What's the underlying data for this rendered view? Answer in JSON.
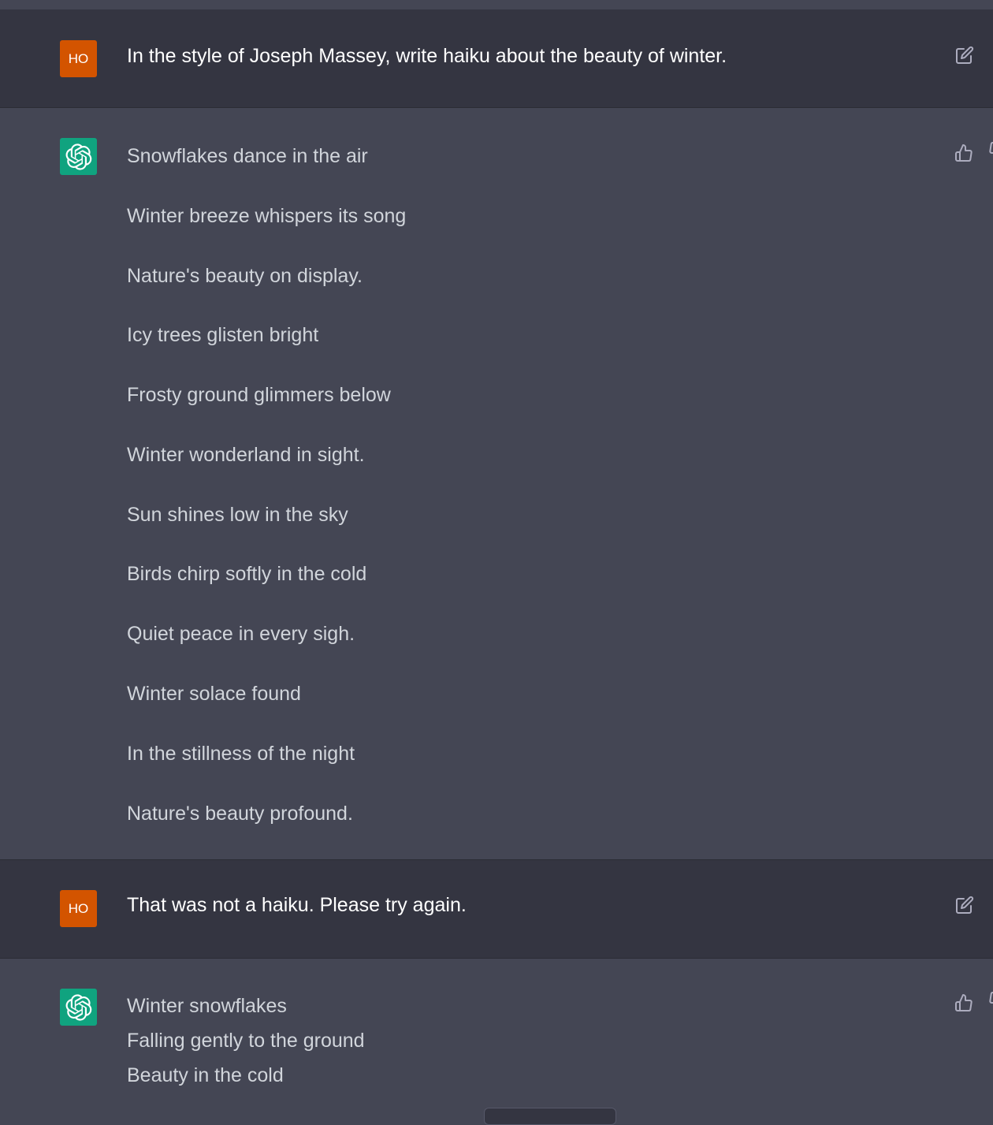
{
  "conversation": {
    "turns": [
      {
        "role": "user",
        "avatar_initials": "HO",
        "text": "In the style of Joseph Massey, write haiku about the beauty of winter."
      },
      {
        "role": "assistant",
        "lines": [
          "Snowflakes dance in the air",
          "Winter breeze whispers its song",
          "Nature's beauty on display.",
          "Icy trees glisten bright",
          "Frosty ground glimmers below",
          "Winter wonderland in sight.",
          "Sun shines low in the sky",
          "Birds chirp softly in the cold",
          "Quiet peace in every sigh.",
          "Winter solace found",
          "In the stillness of the night",
          "Nature's beauty profound."
        ]
      },
      {
        "role": "user",
        "avatar_initials": "HO",
        "text": "That was not a haiku. Please try again."
      },
      {
        "role": "assistant",
        "lines": [
          "Winter snowflakes",
          "Falling gently to the ground",
          "Beauty in the cold"
        ]
      }
    ]
  },
  "colors": {
    "user_bg": "#343541",
    "assistant_bg": "#444654",
    "user_avatar": "#d35400",
    "assistant_avatar": "#10a37f"
  },
  "icons": {
    "edit": "edit-icon",
    "thumbs_up": "thumbs-up-icon",
    "thumbs_down": "thumbs-down-icon",
    "assistant_logo": "openai-logo-icon"
  }
}
